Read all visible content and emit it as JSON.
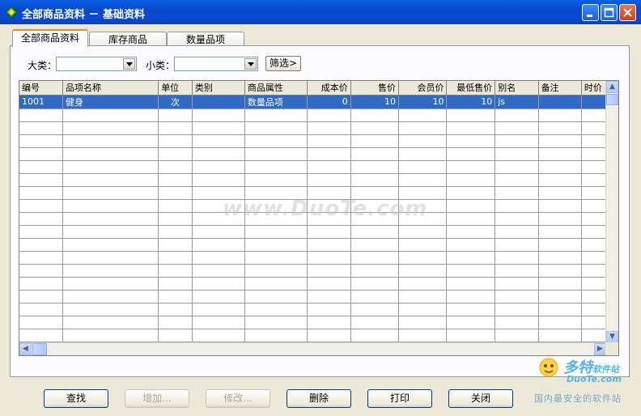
{
  "window": {
    "title": "全部商品资料 － 基础资料"
  },
  "tabs": [
    {
      "label": "全部商品资料",
      "active": true
    },
    {
      "label": "库存商品",
      "active": false
    },
    {
      "label": "数量品项",
      "active": false
    }
  ],
  "filters": {
    "major_label": "大类：",
    "major_value": "",
    "minor_label": "小类：",
    "minor_value": "",
    "filter_button": "筛选>"
  },
  "table": {
    "columns": [
      "编号",
      "品项名称",
      "单位",
      "类别",
      "商品属性",
      "成本价",
      "售价",
      "会员价",
      "最低售价",
      "别名",
      "备注",
      "时价"
    ],
    "rows": [
      [
        "1001",
        "健身",
        "次",
        "",
        "数量品项",
        "0",
        "10",
        "10",
        "10",
        "js",
        "",
        ""
      ]
    ]
  },
  "buttons": {
    "find": "查找",
    "add": "增加...",
    "edit": "修改...",
    "delete": "删除",
    "print": "打印",
    "close": "关闭"
  },
  "watermark": "www.DuoTe.com",
  "logo": {
    "brand": "多特",
    "brand_tag": "软件站",
    "sub": "DuoTe.com",
    "tagline": "国内最安全的软件站"
  }
}
